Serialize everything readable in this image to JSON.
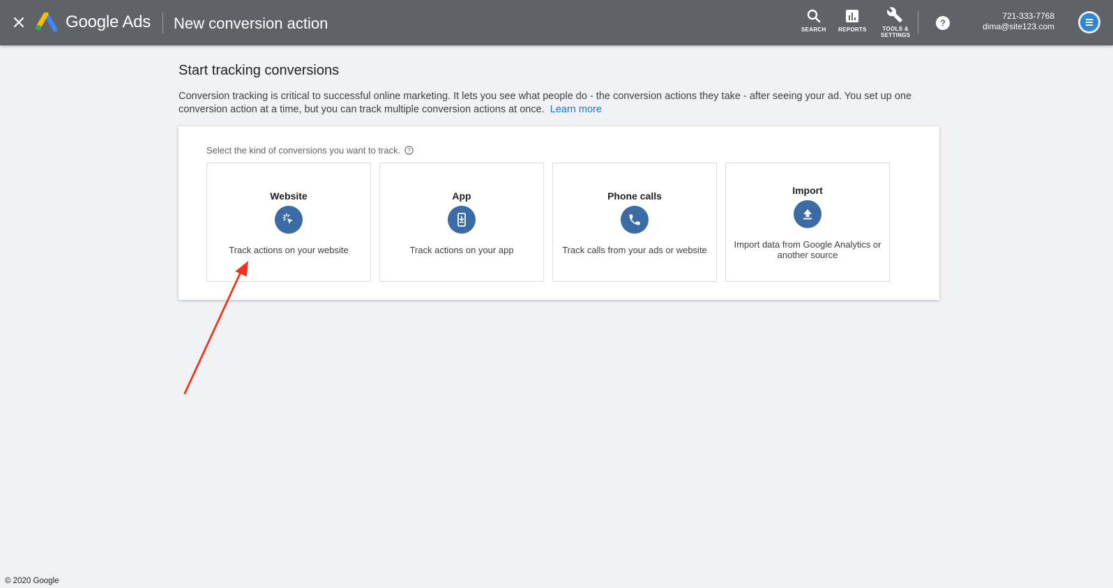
{
  "header": {
    "app_name": "Google Ads",
    "page_title": "New conversion action",
    "tools": [
      {
        "label": "SEARCH",
        "icon": "search-icon"
      },
      {
        "label": "REPORTS",
        "icon": "bar-chart-icon"
      },
      {
        "label": "TOOLS &",
        "label2": "SETTINGS",
        "icon": "wrench-icon"
      }
    ],
    "account": {
      "phone": "721-333-7768",
      "email": "dima@site123.com"
    }
  },
  "main": {
    "heading": "Start tracking conversions",
    "description": "Conversion tracking is critical to successful online marketing. It lets you see what people do - the conversion actions they take - after seeing your ad. You set up one conversion action at a time, but you can track multiple conversion actions at once.",
    "learn_more": "Learn more",
    "prompt": "Select the kind of conversions you want to track.",
    "options": [
      {
        "title": "Website",
        "desc": "Track actions on your website",
        "icon": "cursor-click-icon"
      },
      {
        "title": "App",
        "desc": "Track actions on your app",
        "icon": "phone-download-icon"
      },
      {
        "title": "Phone calls",
        "desc": "Track calls from your ads or website",
        "icon": "phone-call-icon"
      },
      {
        "title": "Import",
        "desc": "Import data from Google Analytics or another source",
        "icon": "upload-icon"
      }
    ]
  },
  "footer": {
    "copyright": "© 2020 Google"
  },
  "colors": {
    "topbar": "#5f6368",
    "accent": "#1a73e8",
    "icon_circle": "#3b6ba5",
    "annotation_arrow": "#f2331f"
  }
}
